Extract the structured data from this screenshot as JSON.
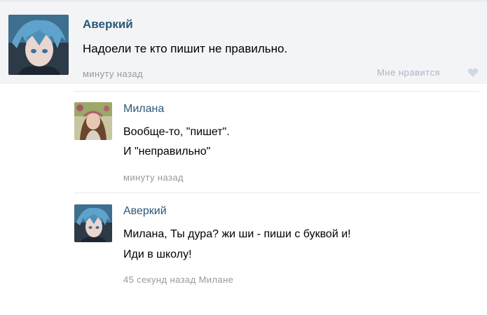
{
  "post": {
    "author": "Аверкий",
    "text": "Надоели те кто пишит не правильно.",
    "time": "минуту назад",
    "like_label": "Мне нравится"
  },
  "comments": [
    {
      "author": "Милана",
      "lines": [
        "Вообще-то, \"пишет\".",
        "И \"неправильно\""
      ],
      "time": "минуту назад"
    },
    {
      "author": "Аверкий",
      "lines": [
        "Милана, Ты дура? жи ши - пиши с буквой и!",
        "Иди в школу!"
      ],
      "time": "45 секунд назад Милане"
    }
  ],
  "colors": {
    "name": "#2b587a",
    "meta": "#999999",
    "like": "#a8b6c6",
    "post_bg": "#f3f4f6"
  },
  "icons": {
    "like": "heart-icon"
  }
}
